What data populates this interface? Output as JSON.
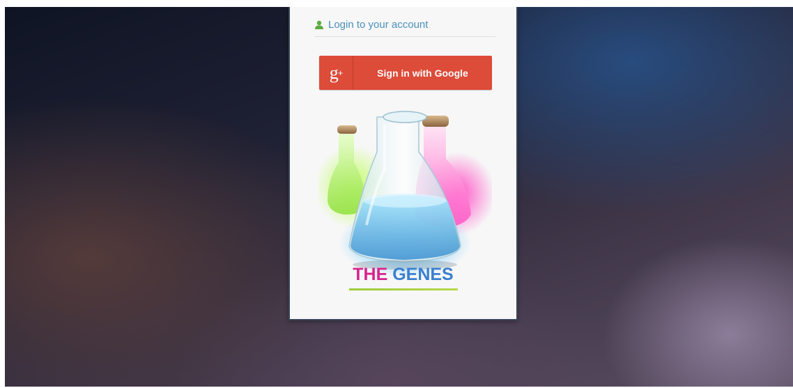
{
  "header": {
    "login_label": "Login to your account"
  },
  "google_button": {
    "icon_text": "g",
    "icon_plus": "+",
    "label": "Sign in with Google",
    "color": "#dd4b39"
  },
  "logo": {
    "brand_word_1": "THE",
    "brand_word_2": "GENES",
    "brand_color_1": "#d6248e",
    "brand_color_2": "#3a7fd0"
  },
  "icons": {
    "user": "user-icon",
    "google": "google-plus-icon",
    "logo": "flasks-logo"
  }
}
